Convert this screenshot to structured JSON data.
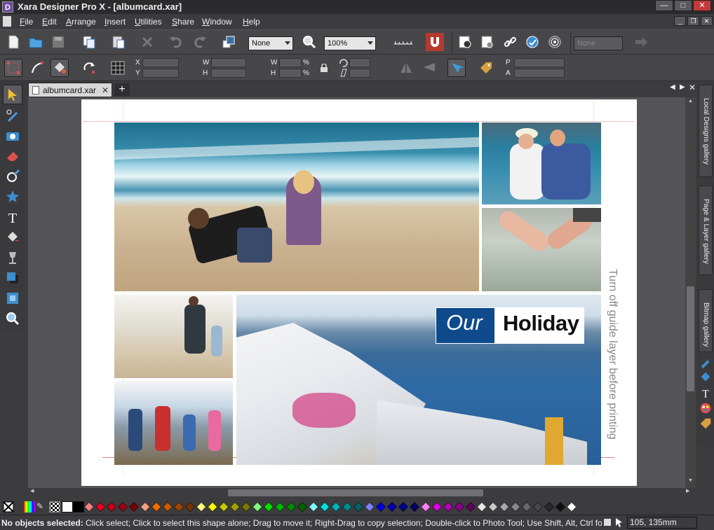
{
  "window": {
    "title": "Xara Designer Pro X - [albumcard.xar]",
    "icon_letter": "D"
  },
  "menu": [
    "File",
    "Edit",
    "Arrange",
    "Insert",
    "Utilities",
    "Share",
    "Window",
    "Help"
  ],
  "menu_underline": [
    "F",
    "E",
    "A",
    "I",
    "U",
    "S",
    "W",
    "H"
  ],
  "toolbar": {
    "quality_select": "None",
    "zoom_select": "100%",
    "name_select": "None"
  },
  "infobar": {
    "x_label": "X",
    "y_label": "Y",
    "w_label": "W",
    "h_label": "H",
    "w2_label": "W",
    "h2_label": "H",
    "pct1": "%",
    "pct2": "%",
    "p_label": "P",
    "a_label": "A"
  },
  "document": {
    "tab_label": "albumcard.xar",
    "guide_text": "Turn off guide layer before printing",
    "title_word1": "Our",
    "title_word2": "Holiday",
    "title_box_color": "#0e4a8c"
  },
  "galleries": [
    "Local Designs gallery",
    "Page & Layer gallery",
    "Bitmap gallery"
  ],
  "palette": [
    "#ffffff",
    "#000000",
    "#f08080",
    "#e8001c",
    "#c80014",
    "#a00014",
    "#78000a",
    "#f4a080",
    "#f07000",
    "#c85a00",
    "#a04600",
    "#783200",
    "#ffff80",
    "#ffff00",
    "#c8c800",
    "#a0a000",
    "#787800",
    "#80ff80",
    "#00e000",
    "#00b400",
    "#008c00",
    "#006400",
    "#80ffff",
    "#00e0e0",
    "#00b4b4",
    "#008c8c",
    "#006464",
    "#8080ff",
    "#0000e0",
    "#0000b4",
    "#00008c",
    "#000064",
    "#ff80ff",
    "#e000e0",
    "#b400b4",
    "#8c008c",
    "#640064",
    "#e8e8e8",
    "#c8c8c8",
    "#a8a8a8",
    "#888888",
    "#686868",
    "#484848",
    "#282828",
    "#101010",
    "#ffffff"
  ],
  "status": {
    "bold": "No objects selected:",
    "text": " Click select; Click to select this shape alone; Drag to move it; Right-Drag to copy selection; Double-click to Photo Tool; Use Shift, Alt, Ctrl for c",
    "coords": "105, 135mm"
  }
}
